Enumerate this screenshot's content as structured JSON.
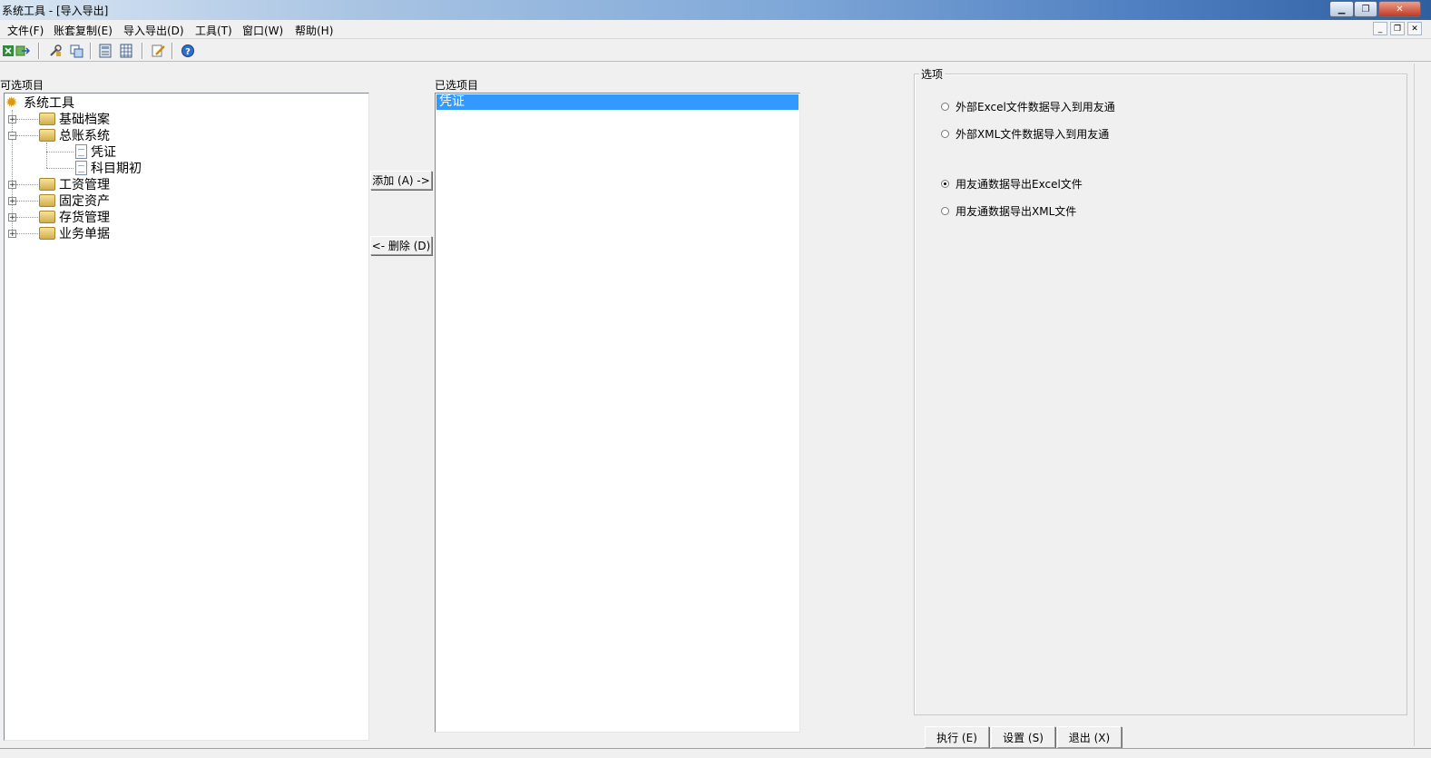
{
  "window": {
    "title": "系统工具 - [导入导出]",
    "controls": {
      "minimize": "▁",
      "restore": "❐",
      "close": "✕"
    },
    "mdi_controls": {
      "minimize": "_",
      "restore": "❐",
      "close": "✕"
    }
  },
  "menu": [
    "文件(F)",
    "账套复制(E)",
    "导入导出(D)",
    "工具(T)",
    "窗口(W)",
    "帮助(H)"
  ],
  "toolbar": {
    "icons": [
      "excel-icon",
      "export-icon",
      "wrench-icon",
      "copy-icon",
      "calc-icon",
      "grid-icon",
      "edit-icon",
      "help-icon"
    ]
  },
  "available": {
    "label": "可选项目",
    "root": "系统工具",
    "nodes": [
      {
        "label": "基础档案",
        "expander": "+"
      },
      {
        "label": "总账系统",
        "expander": "−"
      },
      {
        "label": "凭证"
      },
      {
        "label": "科目期初"
      },
      {
        "label": "工资管理",
        "expander": "+"
      },
      {
        "label": "固定资产",
        "expander": "+"
      },
      {
        "label": "存货管理",
        "expander": "+"
      },
      {
        "label": "业务单据",
        "expander": "+"
      }
    ]
  },
  "transfer": {
    "add_label": "添加 (A) ->",
    "remove_label": "<- 删除 (D)"
  },
  "selected": {
    "label": "已选项目",
    "items": [
      "凭证"
    ]
  },
  "options": {
    "legend": "选项",
    "radios": [
      {
        "label": "外部Excel文件数据导入到用友通",
        "checked": false
      },
      {
        "label": "外部XML文件数据导入到用友通",
        "checked": false
      },
      {
        "label": "用友通数据导出Excel文件",
        "checked": true
      },
      {
        "label": "用友通数据导出XML文件",
        "checked": false
      }
    ]
  },
  "actions": {
    "execute": "执行 (E)",
    "settings": "设置 (S)",
    "exit": "退出 (X)"
  }
}
